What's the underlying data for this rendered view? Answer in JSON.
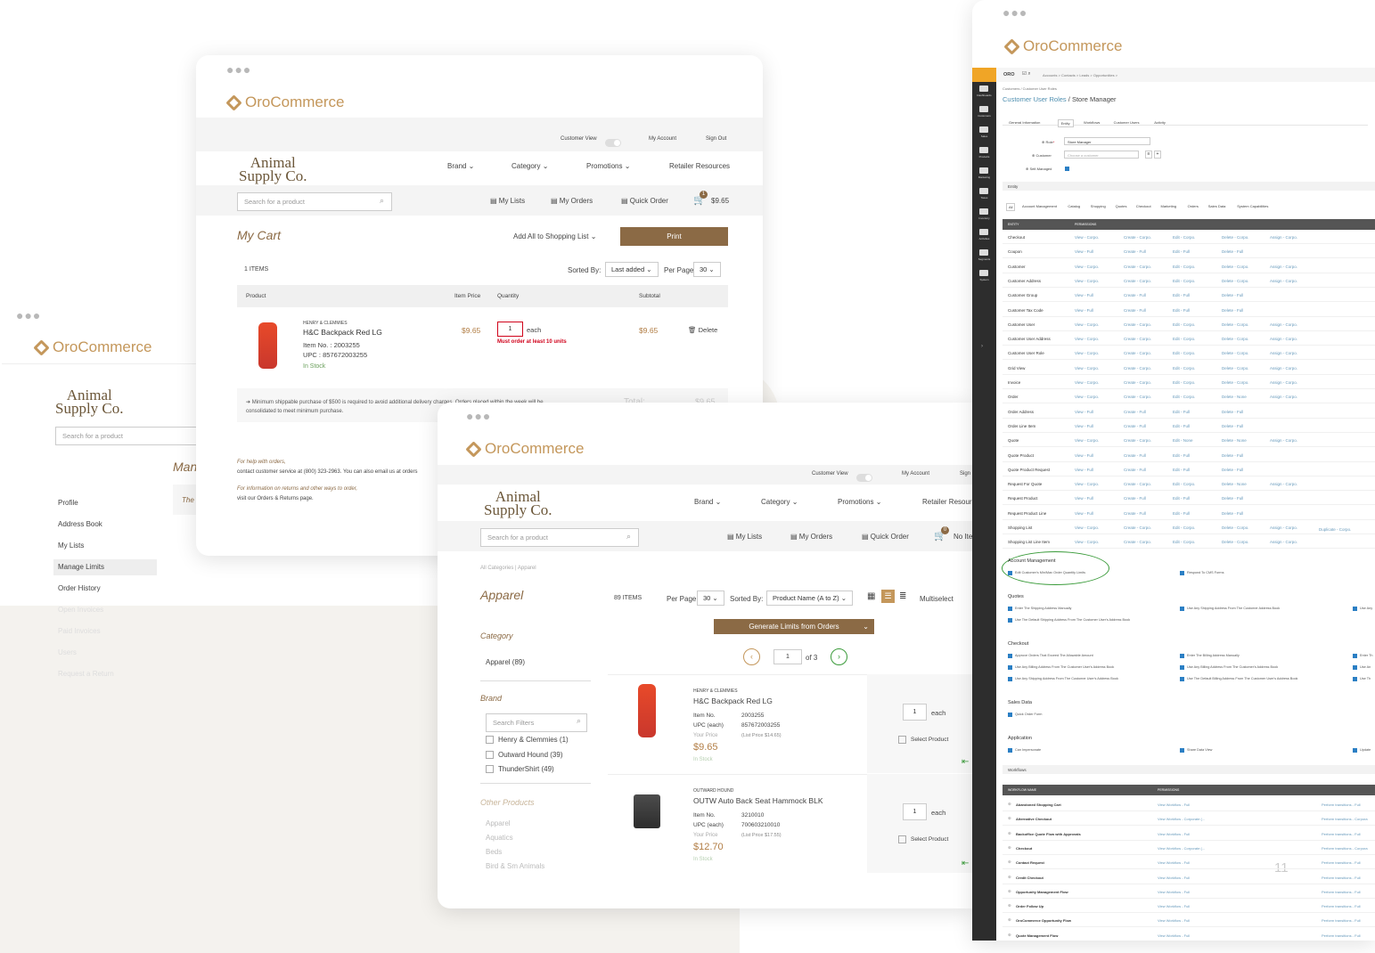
{
  "brand": {
    "oro": "OroCommerce",
    "store_line1": "Animal",
    "store_line2": "Supply Co."
  },
  "win_acct": {
    "search_placeholder": "Search for a product",
    "menu": [
      "Profile",
      "Address Book",
      "My Lists",
      "Manage Limits",
      "Order History",
      "Open Invoices",
      "Paid Invoices",
      "Users",
      "Request a Return"
    ],
    "heading": "Man",
    "note": "The"
  },
  "win_cart": {
    "top": {
      "customer_view": "Customer View",
      "my_account": "My Account",
      "sign_out": "Sign Out"
    },
    "nav": {
      "brand": "Brand",
      "category": "Category",
      "promotions": "Promotions",
      "retailer": "Retailer Resources"
    },
    "search_placeholder": "Search for a product",
    "links": {
      "my_lists": "My Lists",
      "my_orders": "My Orders",
      "quick_order": "Quick Order",
      "cart_total": "$9.65",
      "cart_count": "1"
    },
    "title": "My Cart",
    "add_all": "Add All to Shopping List",
    "print": "Print",
    "items": "1 ITEMS",
    "sorted_by": "Sorted By:",
    "sort_val": "Last added",
    "per_page": "Per Page",
    "per_val": "30",
    "cols": {
      "product": "Product",
      "item_price": "Item Price",
      "quantity": "Quantity",
      "subtotal": "Subtotal"
    },
    "item": {
      "maker": "HENRY & CLEMMIES",
      "name": "H&C Backpack Red LG",
      "item_no": "Item No. : 2003255",
      "upc": "UPC : 857672003255",
      "stock": "In Stock",
      "price": "$9.65",
      "qty": "1",
      "unit": "each",
      "warn": "Must order at least 10 units",
      "subtotal": "$9.65",
      "delete": "Delete"
    },
    "notice": "Minimum shippable purchase of $500 is required to avoid additional delivery charges. Orders placed within the week will be consolidated to meet minimum purchase.",
    "total_label": "Total:",
    "total_val": "$9.65",
    "help1": "For help with orders,",
    "help2": "contact customer service at (800) 323-2963. You can also email us at orders",
    "ret1": "For information on returns and other ways to order,",
    "ret2": "visit our Orders & Returns page."
  },
  "win_apparel": {
    "top": {
      "customer_view": "Customer View",
      "my_account": "My Account",
      "sign": "Sign"
    },
    "nav": {
      "brand": "Brand",
      "category": "Category",
      "promotions": "Promotions",
      "retailer": "Retailer Resour"
    },
    "search_placeholder": "Search for a product",
    "links": {
      "my_lists": "My Lists",
      "my_orders": "My Orders",
      "quick_order": "Quick Order",
      "no_items": "No Ite",
      "cart_count": "0"
    },
    "breadcrumb": "All Categories  |  Apparel",
    "title": "Apparel",
    "items": "89 ITEMS",
    "per_page": "Per Page",
    "per_val": "30",
    "sorted_by": "Sorted By:",
    "sort_val": "Product Name (A to Z)",
    "multiselect": "Multiselect",
    "generate": "Generate Limits from Orders",
    "page": "1",
    "of": "of 3",
    "category_h": "Category",
    "category_item": "Apparel (89)",
    "brand_h": "Brand",
    "filter_placeholder": "Search Filters",
    "brands": [
      "Henry & Clemmies (1)",
      "Outward Hound (39)",
      "ThunderShirt (49)"
    ],
    "other_h": "Other Products",
    "other": [
      "Apparel",
      "Aquatics",
      "Beds",
      "Bird & Sm Animals"
    ],
    "products": [
      {
        "maker": "HENRY & CLEMMIES",
        "name": "H&C Backpack Red LG",
        "item_no_l": "Item No.",
        "item_no": "2003255",
        "upc_l": "UPC (each)",
        "upc": "857672003255",
        "yp_l": "Your Price",
        "list": "(List Price $14.65)",
        "price": "$9.65",
        "stock": "In Stock",
        "qty": "1",
        "unit": "each",
        "select": "Select Product"
      },
      {
        "maker": "OUTWARD HOUND",
        "name": "OUTW Auto Back Seat Hammock BLK",
        "item_no_l": "Item No.",
        "item_no": "3210010",
        "upc_l": "UPC (each)",
        "upc": "700603210010",
        "yp_l": "Your Price",
        "list": "(List Price $17.55)",
        "price": "$12.70",
        "stock": "In Stock",
        "qty": "1",
        "unit": "each",
        "select": "Select Product"
      }
    ]
  },
  "win_admin": {
    "topbar": {
      "oro": "ORO",
      "crumbs": "Accounts >   Contacts >   Leads >   Opportunities >"
    },
    "side": [
      "Dashboards",
      "Customers",
      "Sales",
      "Products",
      "Marketing",
      "Taxes",
      "Inventory",
      "Activities",
      "Segments",
      "System"
    ],
    "breadcrumb": "Customers / Customer User Roles",
    "title_link": "Customer User Roles",
    "title_rest": " / Store Manager",
    "tabs": [
      "General Information",
      "Entity",
      "Workflows",
      "Customer Users",
      "Activity"
    ],
    "role_label": "Role",
    "role_val": "Store Manager",
    "customer_label": "Customer",
    "customer_ph": "Choose a customer",
    "self_label": "Self-Managed",
    "entity_h": "Entity",
    "entity_tabs": [
      "All",
      "Account Management",
      "Catalog",
      "Shopping",
      "Quotes",
      "Checkout",
      "Marketing",
      "Orders",
      "Sales Data",
      "System Capabilities"
    ],
    "table_head": [
      "ENTITY",
      "PERMISSIONS"
    ],
    "rows": [
      [
        "Checkout",
        "View - Corpo.",
        "Create - Corpo.",
        "Edit - Corpo.",
        "Delete - Corpo.",
        "Assign - Corpo."
      ],
      [
        "Coupon",
        "View - Full",
        "Create - Full",
        "Edit - Full",
        "Delete - Full",
        ""
      ],
      [
        "Customer",
        "View - Corpo.",
        "Create - Corpo.",
        "Edit - Corpo.",
        "Delete - Corpo.",
        "Assign - Corpo."
      ],
      [
        "Customer Address",
        "View - Corpo.",
        "Create - Corpo.",
        "Edit - Corpo.",
        "Delete - Corpo.",
        "Assign - Corpo."
      ],
      [
        "Customer Group",
        "View - Full",
        "Create - Full",
        "Edit - Full",
        "Delete - Full",
        ""
      ],
      [
        "Customer Tax Code",
        "View - Full",
        "Create - Full",
        "Edit - Full",
        "Delete - Full",
        ""
      ],
      [
        "Customer User",
        "View - Corpo.",
        "Create - Corpo.",
        "Edit - Corpo.",
        "Delete - Corpo.",
        "Assign - Corpo."
      ],
      [
        "Customer User Address",
        "View - Corpo.",
        "Create - Corpo.",
        "Edit - Corpo.",
        "Delete - Corpo.",
        "Assign - Corpo."
      ],
      [
        "Customer User Role",
        "View - Corpo.",
        "Create - Corpo.",
        "Edit - Corpo.",
        "Delete - Corpo.",
        "Assign - Corpo."
      ],
      [
        "Grid View",
        "View - Corpo.",
        "Create - Corpo.",
        "Edit - Corpo.",
        "Delete - Corpo.",
        "Assign - Corpo."
      ],
      [
        "Invoice",
        "View - Corpo.",
        "Create - Corpo.",
        "Edit - Corpo.",
        "Delete - Corpo.",
        "Assign - Corpo."
      ],
      [
        "Order",
        "View - Corpo.",
        "Create - Corpo.",
        "Edit - Corpo.",
        "Delete - None",
        "Assign - Corpo."
      ],
      [
        "Order Address",
        "View - Full",
        "Create - Full",
        "Edit - Full",
        "Delete - Full",
        ""
      ],
      [
        "Order Line Item",
        "View - Full",
        "Create - Full",
        "Edit - Full",
        "Delete - Full",
        ""
      ],
      [
        "Quote",
        "View - Corpo.",
        "Create - Corpo.",
        "Edit - None",
        "Delete - None",
        "Assign - Corpo."
      ],
      [
        "Quote Product",
        "View - Full",
        "Create - Full",
        "Edit - Full",
        "Delete - Full",
        ""
      ],
      [
        "Quote Product Request",
        "View - Full",
        "Create - Full",
        "Edit - Full",
        "Delete - Full",
        ""
      ],
      [
        "Request For Quote",
        "View - Corpo.",
        "Create - Corpo.",
        "Edit - Corpo.",
        "Delete - None",
        "Assign - Corpo."
      ],
      [
        "Request Product",
        "View - Full",
        "Create - Full",
        "Edit - Full",
        "Delete - Full",
        ""
      ],
      [
        "Request Product Line",
        "View - Full",
        "Create - Full",
        "Edit - Full",
        "Delete - Full",
        ""
      ],
      [
        "Shopping List",
        "View - Corpo.",
        "Create - Corpo.",
        "Edit - Corpo.",
        "Delete - Corpo.",
        "Assign - Corpo."
      ],
      [
        "Shopping List Line Item",
        "View - Corpo.",
        "Create - Corpo.",
        "Edit - Corpo.",
        "Delete - Corpo.",
        "Assign - Corpo."
      ]
    ],
    "duplicate": "Duplicate - Corpo.",
    "cap_sections": [
      {
        "h": "Account Management",
        "items": [
          [
            "Edit Customer's Min/Max Order Quantity Limits",
            "Respond To CMS Forms",
            ""
          ]
        ]
      },
      {
        "h": "Quotes",
        "items": [
          [
            "Enter The Shipping Address Manually",
            "Use Any Shipping Address From The Customer Address Book",
            "Use Any"
          ],
          [
            "Use The Default Shipping Address From The Customer User's Address Book",
            "",
            ""
          ]
        ]
      },
      {
        "h": "Checkout",
        "items": [
          [
            "Approve Orders That Exceed The Allowable Amount",
            "Enter The Billing Address Manually",
            "Enter Th"
          ],
          [
            "Use Any Billing Address From The Customer User's Address Book",
            "Use Any Billing Address From The Customer's Address Book",
            "Use An"
          ],
          [
            "Use Any Shipping Address From The Customer User's Address Book",
            "Use The Default Billing Address From The Customer User's Address Book",
            "Use Th"
          ]
        ]
      },
      {
        "h": "Sales Data",
        "items": [
          [
            "Quick Order Form",
            "",
            ""
          ]
        ]
      },
      {
        "h": "Application",
        "items": [
          [
            "Can Impersonate",
            "Share Data View",
            "Update"
          ]
        ]
      }
    ],
    "workflows_h": "Workflows",
    "wf_head": [
      "WORKFLOW NAME",
      "PERMISSIONS"
    ],
    "wf": [
      [
        "Abandoned Shopping Cart",
        "View Workflow - Full",
        "Perform transitions - Full"
      ],
      [
        "Alternative Checkout",
        "View Workflow - Corporate (...",
        "Perform transitions - Corpora"
      ],
      [
        "Backoffice Quote Flow with Approvals",
        "View Workflow - Full",
        "Perform transitions - Full"
      ],
      [
        "Checkout",
        "View Workflow - Corporate (...",
        "Perform transitions - Corpora"
      ],
      [
        "Contact Request",
        "View Workflow - Full",
        "Perform transitions - Full"
      ],
      [
        "Credit Checkout",
        "View Workflow - Full",
        "Perform transitions - Full"
      ],
      [
        "Opportunity Management Flow",
        "View Workflow - Full",
        "Perform transitions - Full"
      ],
      [
        "Order Follow Up",
        "View Workflow - Full",
        "Perform transitions - Full"
      ],
      [
        "OroCommerce Opportunity Flow",
        "View Workflow - Full",
        "Perform transitions - Full"
      ],
      [
        "Quote Management Flow",
        "View Workflow - Full",
        "Perform transitions - Full"
      ]
    ],
    "page_num": "11"
  },
  "colors": {
    "accent": "#8b6a45",
    "oro": "#c4975b",
    "link": "#4f8fb0",
    "warn": "#d0021b",
    "highlight": "#3a9b3a"
  }
}
